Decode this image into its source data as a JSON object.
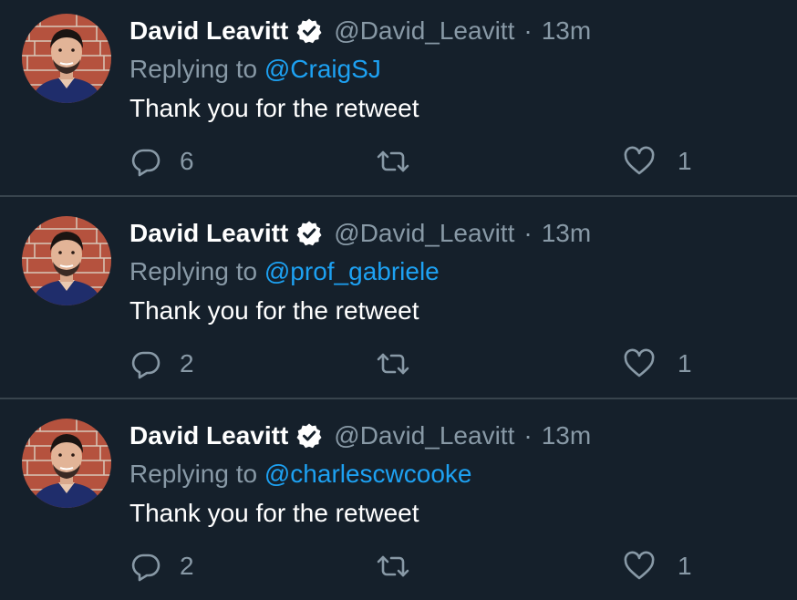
{
  "colors": {
    "background": "#15202b",
    "divider": "#38444d",
    "secondary_text": "#8899a6",
    "link": "#1da1f2",
    "primary_text": "#ffffff"
  },
  "icons": {
    "verified": "verified-badge-icon",
    "reply": "speech-bubble-icon",
    "retweet": "retweet-arrows-icon",
    "like": "heart-outline-icon"
  },
  "tweets": [
    {
      "display_name": "David Leavitt",
      "handle": "@David_Leavitt",
      "separator": "·",
      "time": "13m",
      "replying_prefix": "Replying to",
      "replying_to": "@CraigSJ",
      "text": "Thank you for the retweet",
      "reply_count": "6",
      "like_count": "1"
    },
    {
      "display_name": "David Leavitt",
      "handle": "@David_Leavitt",
      "separator": "·",
      "time": "13m",
      "replying_prefix": "Replying to",
      "replying_to": "@prof_gabriele",
      "text": "Thank you for the retweet",
      "reply_count": "2",
      "like_count": "1"
    },
    {
      "display_name": "David Leavitt",
      "handle": "@David_Leavitt",
      "separator": "·",
      "time": "13m",
      "replying_prefix": "Replying to",
      "replying_to": "@charlescwcooke",
      "text": "Thank you for the retweet",
      "reply_count": "2",
      "like_count": "1"
    }
  ]
}
